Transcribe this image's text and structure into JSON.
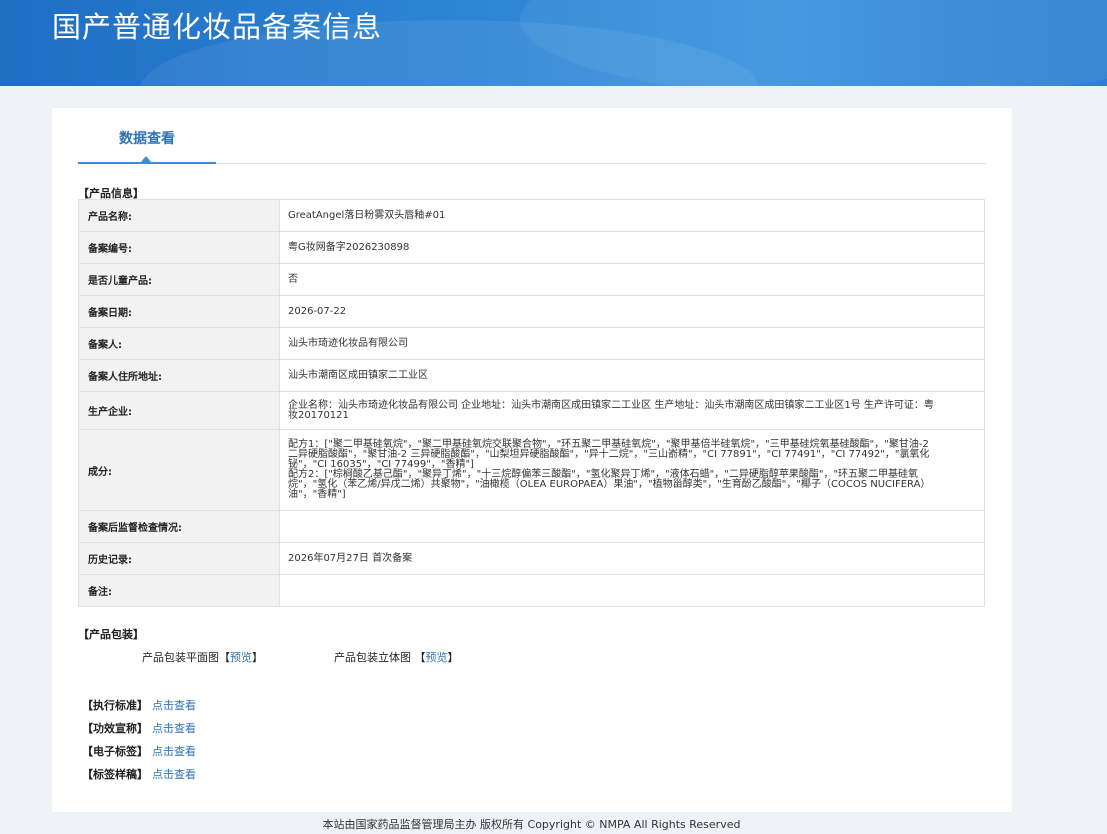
{
  "header": {
    "title": "国产普通化妆品备案信息"
  },
  "tabs": [
    {
      "label": "数据查看"
    }
  ],
  "product_info": {
    "section_label": "【产品信息】",
    "rows": [
      {
        "key": "产品名称:",
        "value": "GreatAngel落日粉雾双头唇釉#01"
      },
      {
        "key": "备案编号:",
        "value": "粤G妆网备字2026230898"
      },
      {
        "key": "是否儿童产品:",
        "value": "否"
      },
      {
        "key": "备案日期:",
        "value": "2026-07-22"
      },
      {
        "key": "备案人:",
        "value": "汕头市琦迹化妆品有限公司"
      },
      {
        "key": "备案人住所地址:",
        "value": "汕头市潮南区成田镇家二工业区"
      },
      {
        "key": "生产企业:",
        "value": "企业名称：汕头市琦迹化妆品有限公司 企业地址：汕头市潮南区成田镇家二工业区 生产地址：汕头市潮南区成田镇家二工业区1号 生产许可证：粤妆20170121"
      },
      {
        "key": "成分:",
        "value": "配方1：[\"聚二甲基硅氧烷\"，\"聚二甲基硅氧烷交联聚合物\"，\"环五聚二甲基硅氧烷\"，\"聚甲基倍半硅氧烷\"，\"三甲基硅烷氧基硅酸酯\"，\"聚甘油-2 二异硬脂酸酯\"，\"聚甘油-2 三异硬脂酸酯\"，\"山梨坦异硬脂酸酯\"，\"异十二烷\"，\"三山嵛精\"，\"CI 77891\"，\"CI 77491\"，\"CI 77492\"，\"氯氧化铋\"，\"CI 16035\"，\"CI 77499\"，\"香精\"]\n配方2：[\"棕榈酸乙基己酯\"，\"聚异丁烯\"，\"十三烷醇偏苯三酸酯\"，\"氢化聚异丁烯\"，\"液体石蜡\"，\"二异硬脂醇苹果酸酯\"，\"环五聚二甲基硅氧烷\"，\"氢化（苯乙烯/异戊二烯）共聚物\"，\"油橄榄（OLEA EUROPAEA）果油\"，\"植物甾醇类\"，\"生育酚乙酸酯\"，\"椰子（COCOS NUCIFERA）油\"，\"香精\"]"
      },
      {
        "key": "备案后监督检查情况:",
        "value": ""
      },
      {
        "key": "历史记录:",
        "value": "2026年07月27日 首次备案"
      },
      {
        "key": "备注:",
        "value": ""
      }
    ]
  },
  "packaging": {
    "section_label": "【产品包装】",
    "flat_label": "产品包装平面图【",
    "flat_link": "预览",
    "flat_close": "】",
    "stereo_label": "产品包装立体图 【",
    "stereo_link": "预览",
    "stereo_close": "】"
  },
  "links": [
    {
      "label": "【执行标准】",
      "action": "点击查看"
    },
    {
      "label": "【功效宣称】",
      "action": "点击查看"
    },
    {
      "label": "【电子标签】",
      "action": "点击查看"
    },
    {
      "label": "【标签样稿】",
      "action": "点击查看"
    }
  ],
  "footer": {
    "text": "本站由国家药品监督管理局主办 版权所有 Copyright © NMPA All Rights Reserved"
  }
}
